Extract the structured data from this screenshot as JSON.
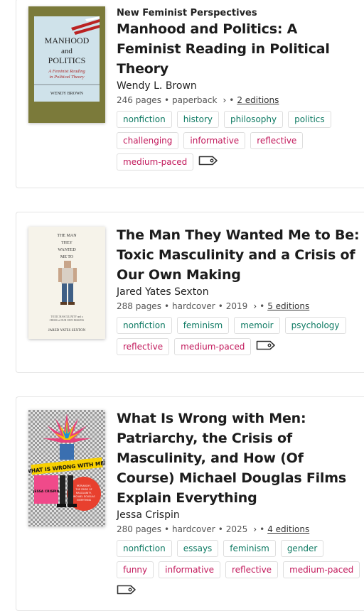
{
  "books": [
    {
      "series": "New Feminist Perspectives",
      "title": "Manhood and Politics: A Feminist Reading in Political Theory",
      "author": "Wendy L. Brown",
      "pages": "246 pages",
      "format": "paperback",
      "year": "",
      "editions": "2 editions",
      "cover": {
        "title": "MANHOOD and POLITICS",
        "subtitle": "A Feminist Reading in Political Theory",
        "author": "WENDY BROWN"
      },
      "tags_green": [
        "nonfiction",
        "history",
        "philosophy",
        "politics"
      ],
      "tags_pink": [
        "challenging",
        "informative",
        "reflective",
        "medium-paced"
      ]
    },
    {
      "series": "",
      "title": "The Man They Wanted Me to Be: Toxic Masculinity and a Crisis of Our Own Making",
      "author": "Jared Yates Sexton",
      "pages": "288 pages",
      "format": "hardcover",
      "year": "2019",
      "editions": "5 editions",
      "cover": {
        "title": "THE MAN THEY WANTED ME TO BE",
        "subtitle": "TOXIC MASCULINITY and a CRISIS of OUR OWN MAKING",
        "author": "JARED YATES SEXTON"
      },
      "tags_green": [
        "nonfiction",
        "feminism",
        "memoir",
        "psychology"
      ],
      "tags_pink": [
        "reflective",
        "medium-paced"
      ]
    },
    {
      "series": "",
      "title": "What Is Wrong with Men: Patriarchy, the Crisis of Masculinity, and How (Of Course) Michael Douglas Films Explain Everything",
      "author": "Jessa Crispin",
      "pages": "280 pages",
      "format": "hardcover",
      "year": "2025",
      "editions": "4 editions",
      "cover": {
        "title": "WHAT IS WRONG WITH MEN",
        "author": "JESSA CRISPIN",
        "subtitle": "PATRIARCHY, THE CRISIS OF MASCULINITY, AND HOW (OF COURSE) MICHAEL DOUGLAS FILMS EXPLAIN EVERYTHING"
      },
      "tags_green": [
        "nonfiction",
        "essays",
        "feminism",
        "gender"
      ],
      "tags_pink": [
        "funny",
        "informative",
        "reflective",
        "medium-paced"
      ]
    }
  ],
  "sep": "•",
  "colors": {
    "green": "#0e7a63",
    "pink": "#c2185b",
    "cover1_bg": "#7b7a3a",
    "cover1_panel": "#cfe2ea"
  }
}
